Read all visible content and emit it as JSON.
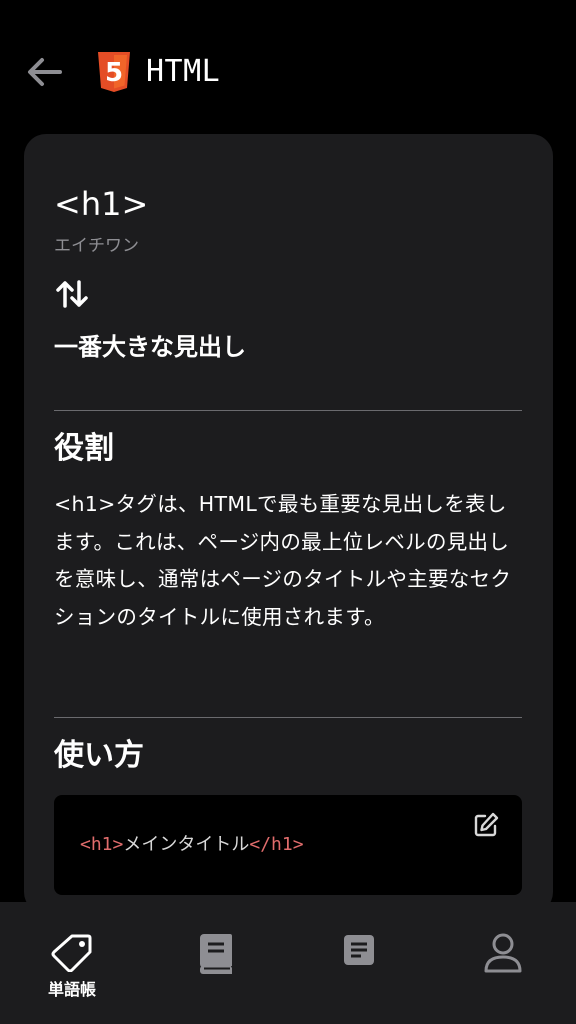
{
  "header": {
    "title": "HTML",
    "back_icon": "arrow-left-icon",
    "logo_icon": "html5-logo",
    "logo_color": "#e44d26",
    "logo_glyph": "5"
  },
  "card": {
    "term": "<h1>",
    "reading": "エイチワン",
    "swap_icon": "swap-vertical-icon",
    "meaning": "一番大きな見出し",
    "role_section": {
      "title": "役割",
      "body": "<h1>タグは、HTMLで最も重要な見出しを表します。これは、ページ内の最上位レベルの見出しを意味し、通常はページのタイトルや主要なセクションのタイトルに使用されます。"
    },
    "usage_section": {
      "title": "使い方",
      "code": {
        "open_tag": "<h1>",
        "content": "メインタイトル",
        "close_tag": "</h1>"
      },
      "edit_icon": "edit-icon"
    }
  },
  "bottom_nav": {
    "items": [
      {
        "icon": "tag-icon",
        "label": "単語帳",
        "active": true
      },
      {
        "icon": "book-icon",
        "label": "",
        "active": false
      },
      {
        "icon": "note-icon",
        "label": "",
        "active": false
      },
      {
        "icon": "user-icon",
        "label": "",
        "active": false
      }
    ]
  },
  "colors": {
    "background": "#000000",
    "card": "#1c1c1e",
    "code_tag": "#e06c6c",
    "muted_text": "#8e8e93",
    "inactive_icon": "#8e8e93"
  }
}
